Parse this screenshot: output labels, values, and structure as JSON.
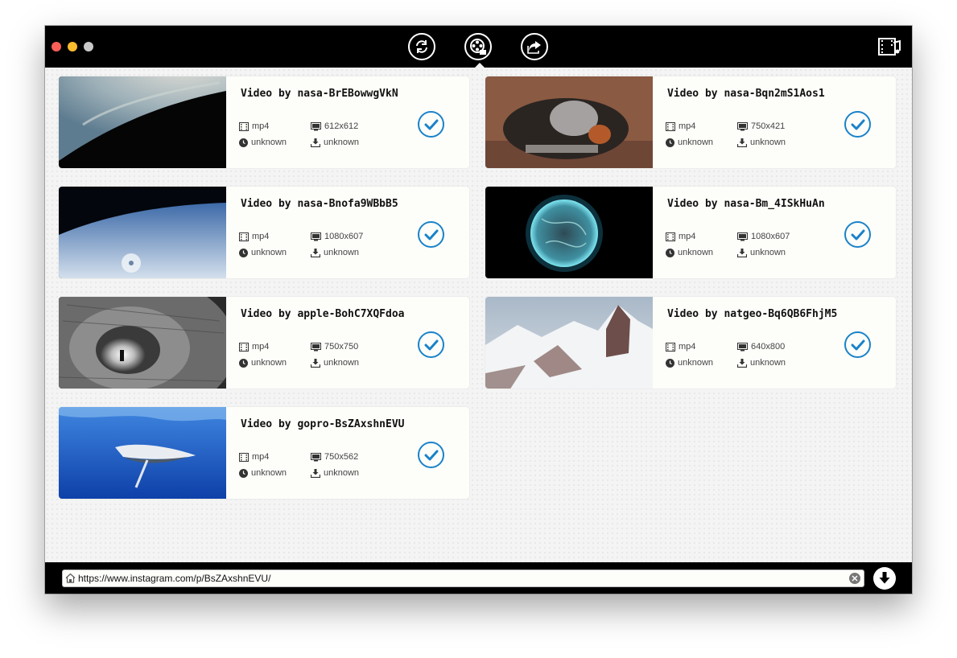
{
  "toolbar": {
    "tools": [
      {
        "name": "convert-icon",
        "active": false
      },
      {
        "name": "video-reel-icon",
        "active": true
      },
      {
        "name": "share-icon",
        "active": false
      }
    ],
    "right_icon": "film-music-icon"
  },
  "videos": [
    {
      "title": "Video by nasa-BrEBowwgVkN",
      "format": "mp4",
      "resolution": "612x612",
      "duration": "unknown",
      "size": "unknown",
      "checked": true
    },
    {
      "title": "Video by nasa-Bqn2mS1Aos1",
      "format": "mp4",
      "resolution": "750x421",
      "duration": "unknown",
      "size": "unknown",
      "checked": true
    },
    {
      "title": "Video by nasa-Bnofa9WBbB5",
      "format": "mp4",
      "resolution": "1080x607",
      "duration": "unknown",
      "size": "unknown",
      "checked": true
    },
    {
      "title": "Video by nasa-Bm_4ISkHuAn",
      "format": "mp4",
      "resolution": "1080x607",
      "duration": "unknown",
      "size": "unknown",
      "checked": true
    },
    {
      "title": "Video by apple-BohC7XQFdoa",
      "format": "mp4",
      "resolution": "750x750",
      "duration": "unknown",
      "size": "unknown",
      "checked": true
    },
    {
      "title": "Video by natgeo-Bq6QB6FhjM5",
      "format": "mp4",
      "resolution": "640x800",
      "duration": "unknown",
      "size": "unknown",
      "checked": true
    },
    {
      "title": "Video by gopro-BsZAxshnEVU",
      "format": "mp4",
      "resolution": "750x562",
      "duration": "unknown",
      "size": "unknown",
      "checked": true
    }
  ],
  "urlbar": {
    "value": "https://www.instagram.com/p/BsZAxshnEVU/"
  },
  "colors": {
    "accent": "#1a82c9",
    "titlebar": "#000000"
  }
}
